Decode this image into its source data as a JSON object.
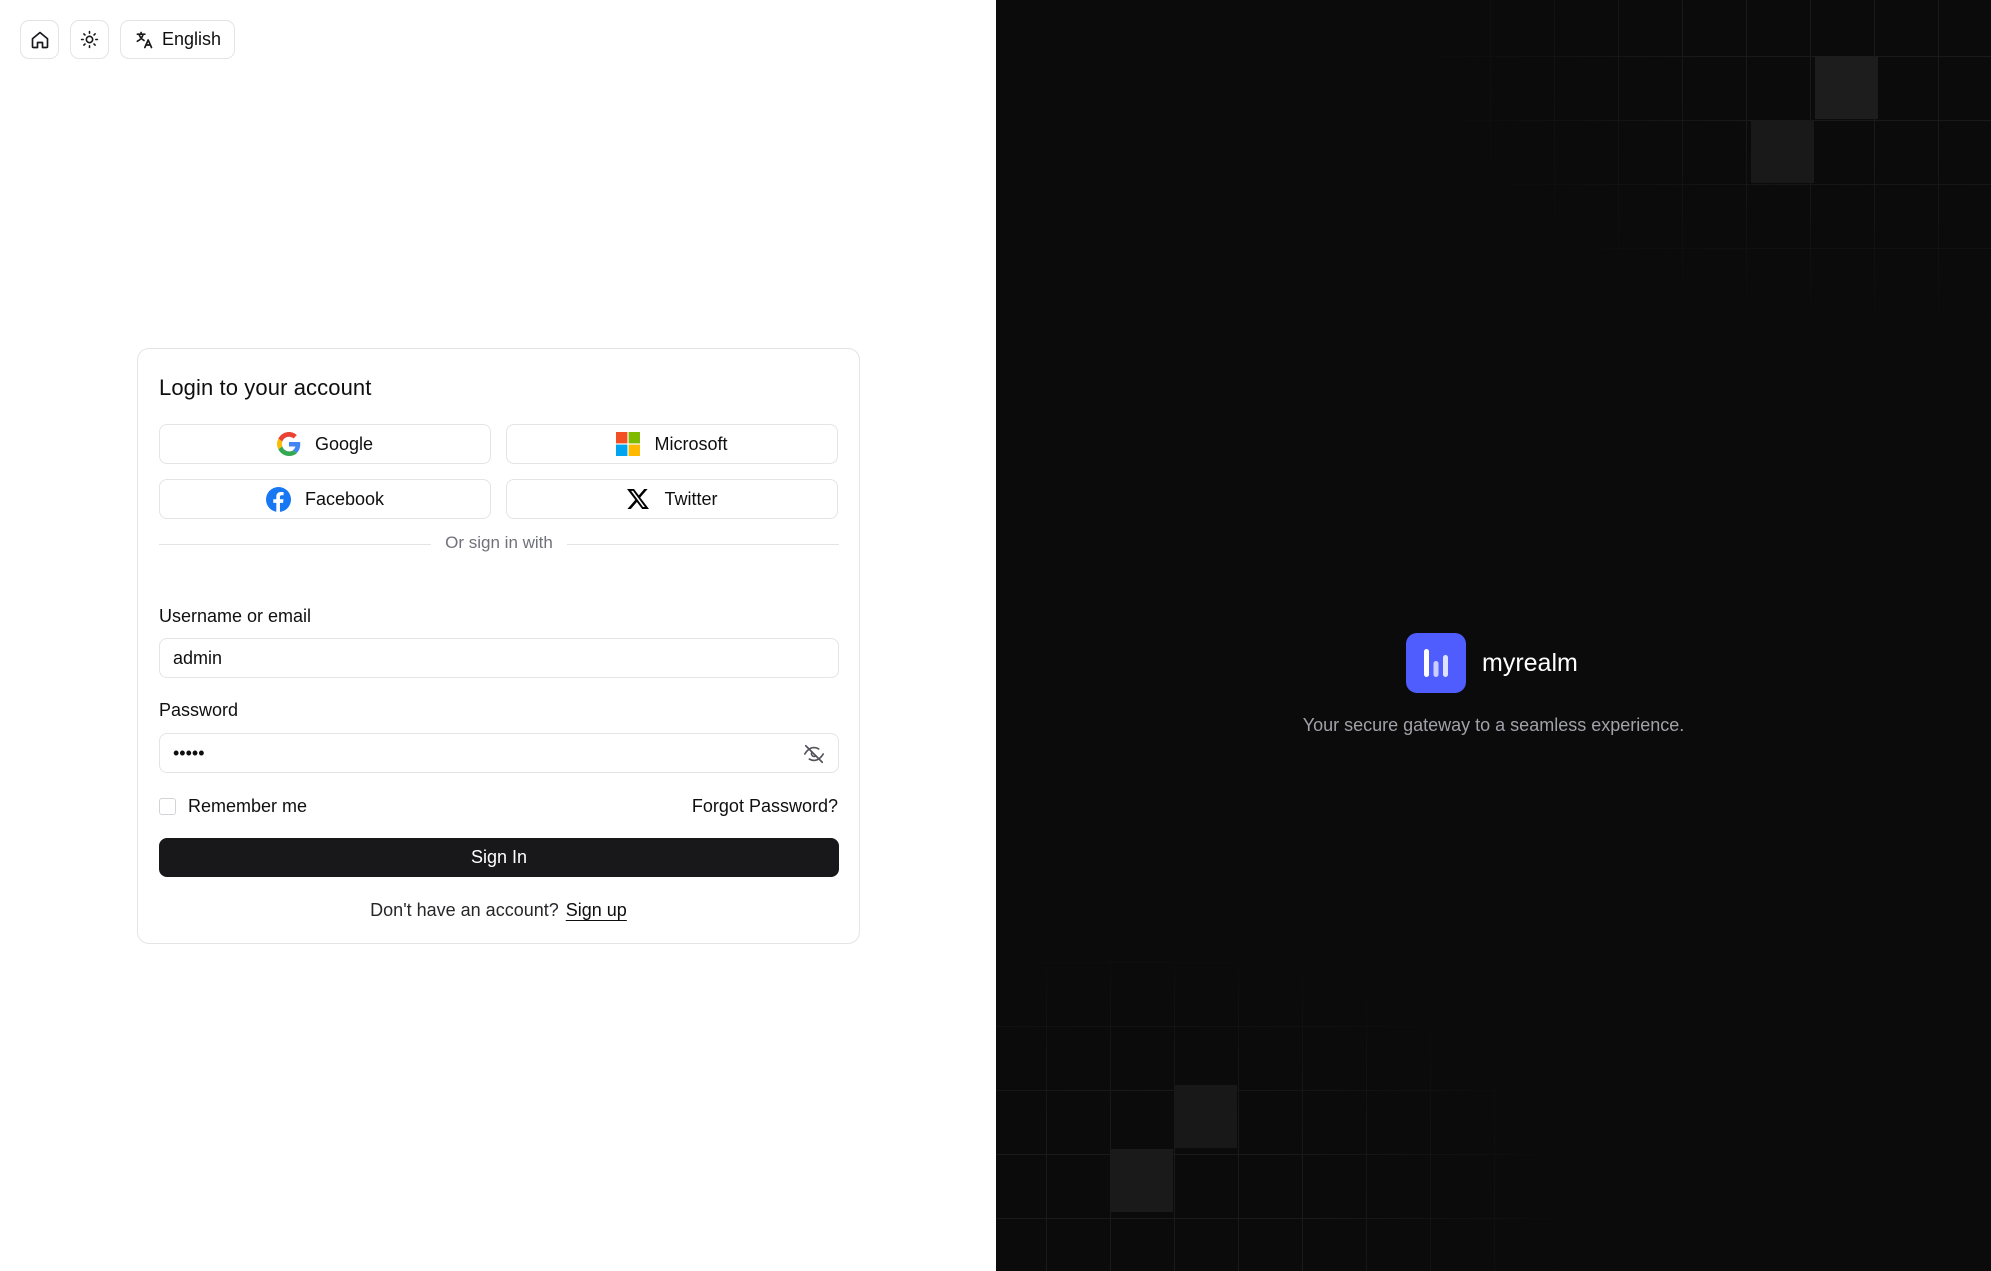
{
  "topbar": {
    "home_icon": "home-icon",
    "theme_icon": "sun-icon",
    "language_label": "English"
  },
  "login": {
    "title": "Login to your account",
    "social": {
      "google": "Google",
      "microsoft": "Microsoft",
      "facebook": "Facebook",
      "twitter": "Twitter"
    },
    "divider_text": "Or sign in with",
    "username_label": "Username or email",
    "username_value": "admin",
    "password_label": "Password",
    "password_value": "•••••",
    "remember_label": "Remember me",
    "forgot_label": "Forgot Password?",
    "signin_label": "Sign In",
    "signup_prompt": "Don't have an account?",
    "signup_link": "Sign up"
  },
  "brand": {
    "name": "myrealm",
    "tagline": "Your secure gateway to a seamless experience.",
    "accent_color": "#4f5dff"
  }
}
